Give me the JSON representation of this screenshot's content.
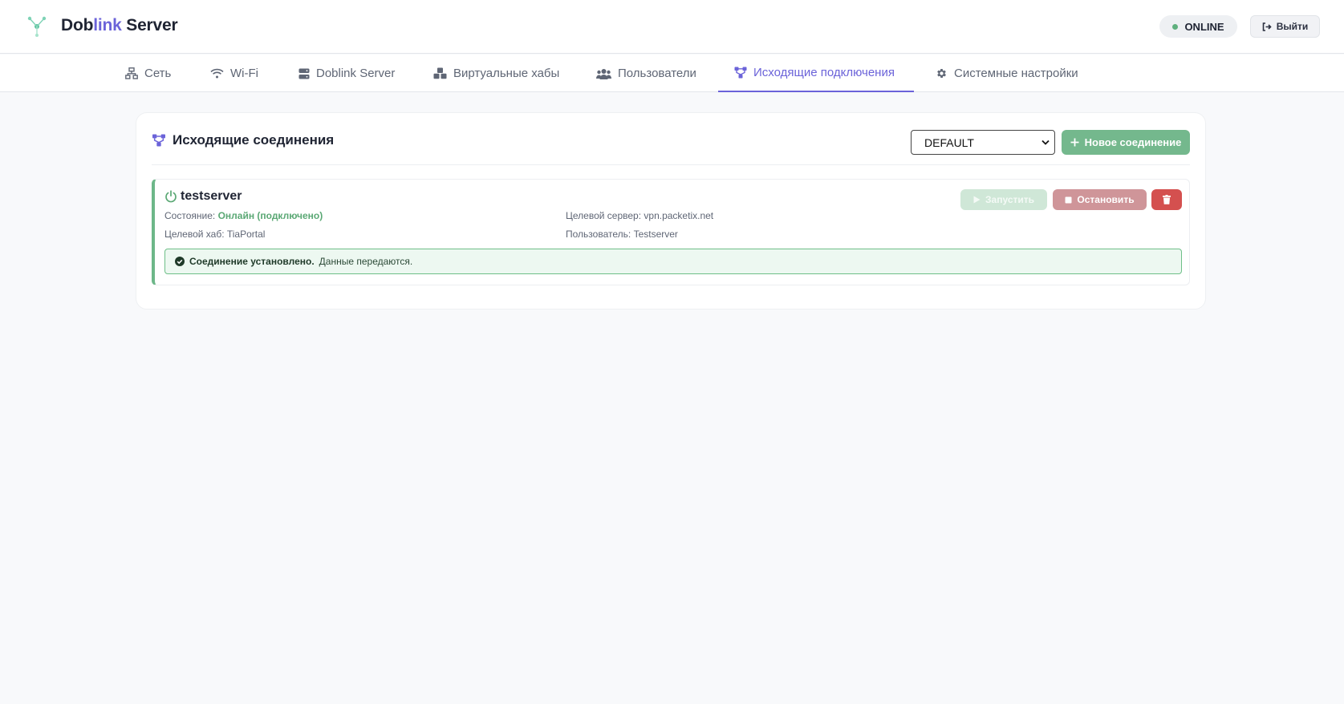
{
  "app": {
    "brand_prefix": "Dob",
    "brand_accent": "link",
    "brand_suffix": " Server",
    "status": "ONLINE",
    "logout_label": "Выйти"
  },
  "nav": {
    "tabs": [
      {
        "label": "Сеть",
        "icon": "network-icon"
      },
      {
        "label": "Wi-Fi",
        "icon": "wifi-icon"
      },
      {
        "label": "Doblink Server",
        "icon": "server-icon"
      },
      {
        "label": "Виртуальные хабы",
        "icon": "cubes-icon"
      },
      {
        "label": "Пользователи",
        "icon": "users-icon"
      },
      {
        "label": "Исходящие подключения",
        "icon": "diagram-icon",
        "active": true
      },
      {
        "label": "Системные настройки",
        "icon": "gear-icon"
      }
    ]
  },
  "panel": {
    "title": "Исходящие соединения",
    "hub_selected": "DEFAULT",
    "new_connection_label": "Новое соединение"
  },
  "connection": {
    "name": "testserver",
    "state_label": "Состояние:",
    "state_value": "Онлайн (подключено)",
    "target_server_label": "Целевой сервер:",
    "target_server_value": "vpn.packetix.net",
    "target_hub_label": "Целевой хаб:",
    "target_hub_value": "TiaPortal",
    "user_label": "Пользователь:",
    "user_value": "Testserver",
    "start_label": "Запустить",
    "stop_label": "Остановить",
    "alert_bold": "Соединение установлено.",
    "alert_text": "Данные передаются."
  },
  "colors": {
    "accent": "#6b63d9",
    "success": "#74b88d",
    "danger": "#d4504f"
  }
}
